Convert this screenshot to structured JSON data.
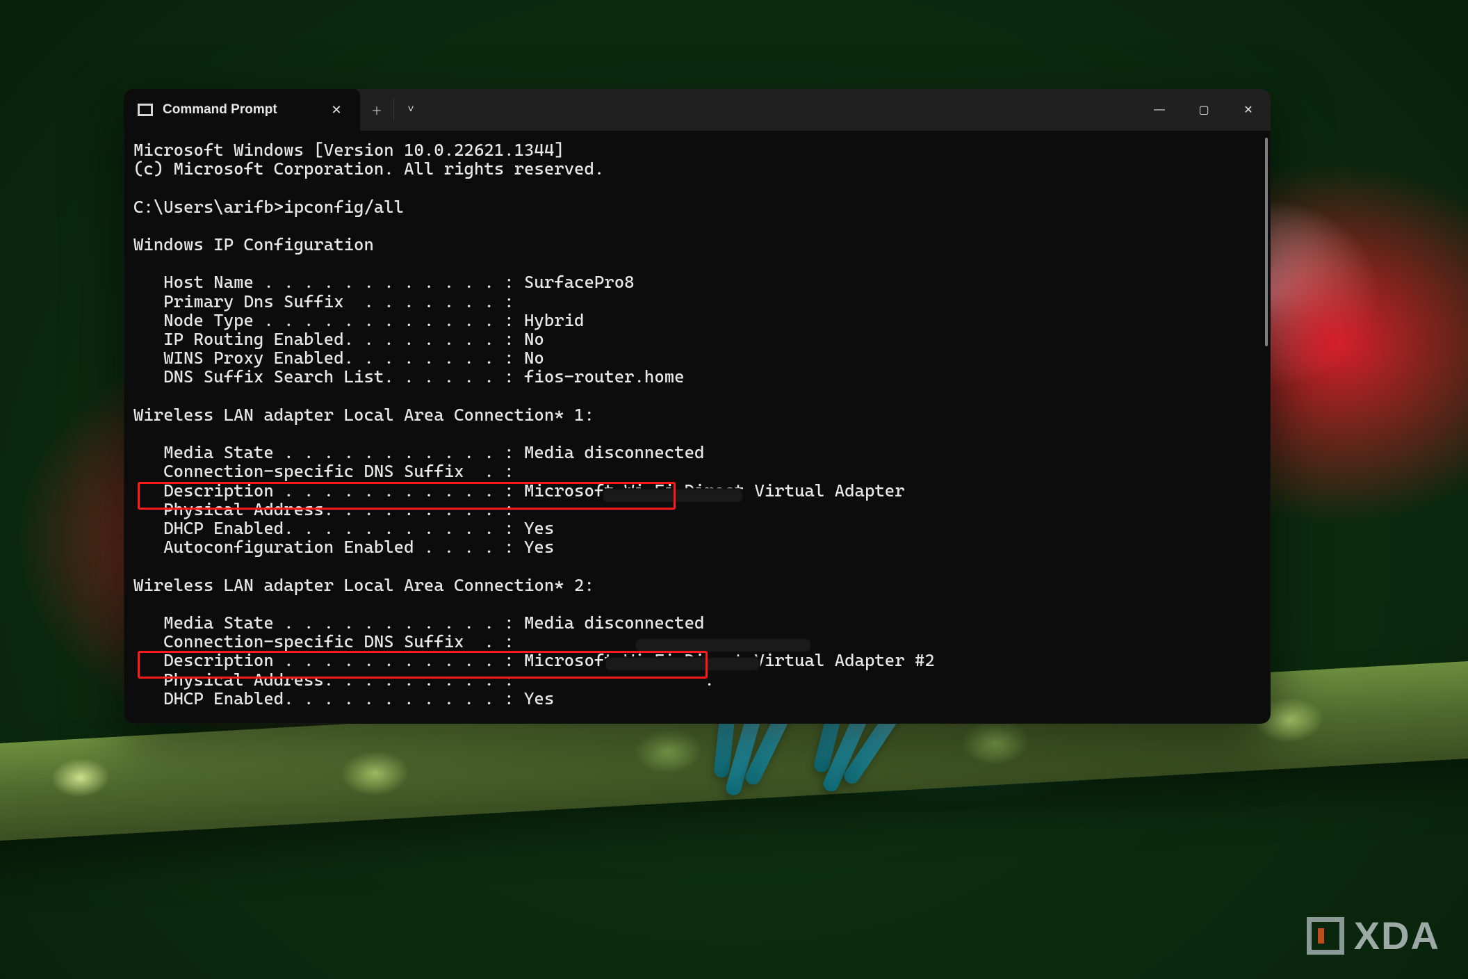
{
  "window": {
    "tab_title": "Command Prompt",
    "icons": {
      "close": "✕",
      "minimize": "—",
      "maximize": "▢",
      "plus": "＋",
      "chevron": "˅"
    }
  },
  "watermark": {
    "text": "XDA"
  },
  "term": {
    "line0": "Microsoft Windows [Version 10.0.22621.1344]",
    "line1": "(c) Microsoft Corporation. All rights reserved.",
    "blank": "",
    "prompt": "C:\\Users\\arifb>ipconfig/all",
    "hdr_ip": "Windows IP Configuration",
    "ip0": "   Host Name . . . . . . . . . . . . : SurfacePro8",
    "ip1": "   Primary Dns Suffix  . . . . . . . :",
    "ip2": "   Node Type . . . . . . . . . . . . : Hybrid",
    "ip3": "   IP Routing Enabled. . . . . . . . : No",
    "ip4": "   WINS Proxy Enabled. . . . . . . . : No",
    "ip5": "   DNS Suffix Search List. . . . . . : fios-router.home",
    "hdr_a1": "Wireless LAN adapter Local Area Connection* 1:",
    "a1_0": "   Media State . . . . . . . . . . . : Media disconnected",
    "a1_1": "   Connection-specific DNS Suffix  . :",
    "a1_2": "   Description . . . . . . . . . . . : Microsoft Wi-Fi Direct Virtual Adapter",
    "a1_3": "   Physical Address. . . . . . . . . :",
    "a1_4": "   DHCP Enabled. . . . . . . . . . . : Yes",
    "a1_5": "   Autoconfiguration Enabled . . . . : Yes",
    "hdr_a2": "Wireless LAN adapter Local Area Connection* 2:",
    "a2_0": "   Media State . . . . . . . . . . . : Media disconnected",
    "a2_1": "   Connection-specific DNS Suffix  . :",
    "a2_2": "   Description . . . . . . . . . . . : Microsoft Wi-Fi Direct Virtual Adapter #2",
    "a2_3": "   Physical Address. . . . . . . . . :                   .",
    "a2_4": "   DHCP Enabled. . . . . . . . . . . : Yes"
  }
}
